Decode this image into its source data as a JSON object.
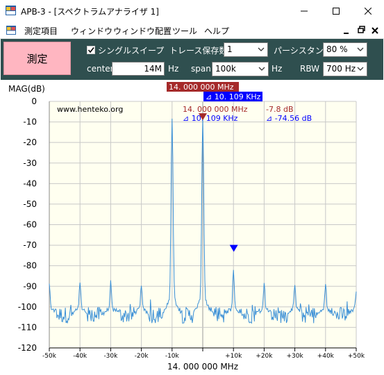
{
  "window": {
    "title": "APB-3 - [スペクトラムアナライザ 1]"
  },
  "menu": [
    "測定項目",
    "ウィンドウ",
    "ウィンドウ配置",
    "ツール",
    "ヘルプ"
  ],
  "controls": {
    "measure_label": "測定",
    "single_sweep_label": "シングルスイープ",
    "single_sweep_checked": true,
    "trace_save_label": "トレース保存数",
    "trace_save_value": "1",
    "persistence_label": "パーシスタンス",
    "persistence_value": "80 %",
    "center_label": "center",
    "center_value": "14M",
    "center_unit": "Hz",
    "span_label": "span",
    "span_value": "100k",
    "span_unit": "Hz",
    "rbw_label": "RBW",
    "rbw_value": "700 Hz"
  },
  "chart_data": {
    "type": "line",
    "ylabel": "MAG(dB)",
    "xlabel": "14. 000 000 MHz",
    "x_range": [
      -50,
      50
    ],
    "y_range": [
      -120,
      0
    ],
    "x_ticks": [
      "-50k",
      "-40k",
      "-30k",
      "-20k",
      "-10k",
      "0",
      "+10k",
      "+20k",
      "+30k",
      "+40k",
      "+50k"
    ],
    "y_ticks": [
      "0",
      "-10",
      "-20",
      "-30",
      "-40",
      "-50",
      "-60",
      "-70",
      "-80",
      "-90",
      "-100",
      "-110",
      "-120"
    ],
    "watermark": "www.henteko.org",
    "marker1": {
      "x": 0,
      "y": -7.8,
      "label_freq": "14. 000 000 MHz",
      "label_level": "-7.8 dB",
      "color": "#a52a2a"
    },
    "marker2": {
      "x": 10.109,
      "y": -74.56,
      "label_freq": "⊿ 10. 109 KHz",
      "label_level": "⊿ -74.56 dB",
      "color": "#0000ff"
    },
    "top_marker_label": "14. 000 000 MHz",
    "top_delta_label": "⊿ 10. 109 KHz",
    "noise_floor": -104,
    "peaks": [
      {
        "x": -10,
        "y": -8
      },
      {
        "x": 0,
        "y": -7.8
      },
      {
        "x": -50,
        "y": -89
      },
      {
        "x": -40,
        "y": -88
      },
      {
        "x": -30,
        "y": -88
      },
      {
        "x": -20,
        "y": -89
      },
      {
        "x": 10,
        "y": -82
      },
      {
        "x": 20,
        "y": -88
      },
      {
        "x": 30,
        "y": -89
      },
      {
        "x": 40,
        "y": -88
      },
      {
        "x": 50,
        "y": -92
      }
    ],
    "colors": {
      "trace": "#3a8fd6",
      "background": "#fffff0",
      "grid": "#c8c8c8"
    }
  }
}
